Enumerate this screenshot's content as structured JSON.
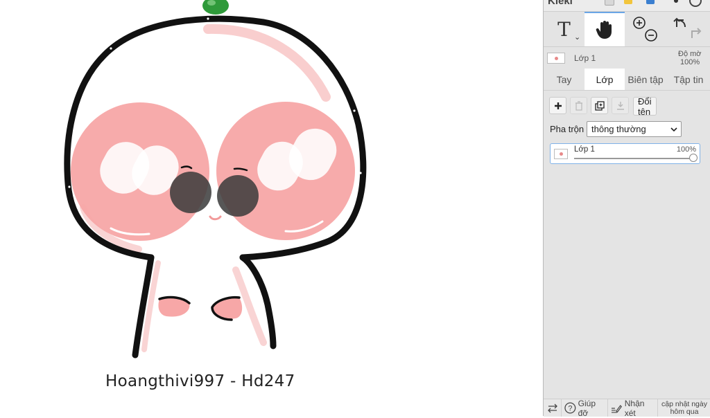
{
  "canvas": {
    "credit_text": "Hoangthivi997 - Hd247"
  },
  "topbar": {
    "brand_text": "Kleki"
  },
  "toolbar": {
    "text_tool_icon": "T",
    "hand_tool_icon": "hand-icon",
    "zoom_in_icon": "zoom-in-icon",
    "zoom_out_icon": "zoom-out-icon",
    "undo_icon": "undo-icon",
    "redo_icon": "redo-icon"
  },
  "layer_summary": {
    "name": "Lớp 1",
    "opacity_label": "Độ mờ",
    "opacity_value": "100%"
  },
  "tabs": [
    {
      "label": "Tay"
    },
    {
      "label": "Lớp"
    },
    {
      "label": "Biên tập"
    },
    {
      "label": "Tập tin"
    }
  ],
  "active_tab": "Lớp",
  "layer_actions": {
    "rename_label": "Đổi tên"
  },
  "blend": {
    "label": "Pha trộn",
    "value": "thông thường"
  },
  "layers": [
    {
      "name": "Lớp 1",
      "opacity_text": "100%",
      "opacity": 1.0
    }
  ],
  "bottombar": {
    "help_label": "Giúp đỡ",
    "feedback_label": "Nhận xét",
    "update_note": "cập nhật ngày hôm qua"
  },
  "colors": {
    "panel_bg": "#e4e4e4",
    "accent": "#6aa6e6",
    "cheek": "#f7a7a7"
  }
}
